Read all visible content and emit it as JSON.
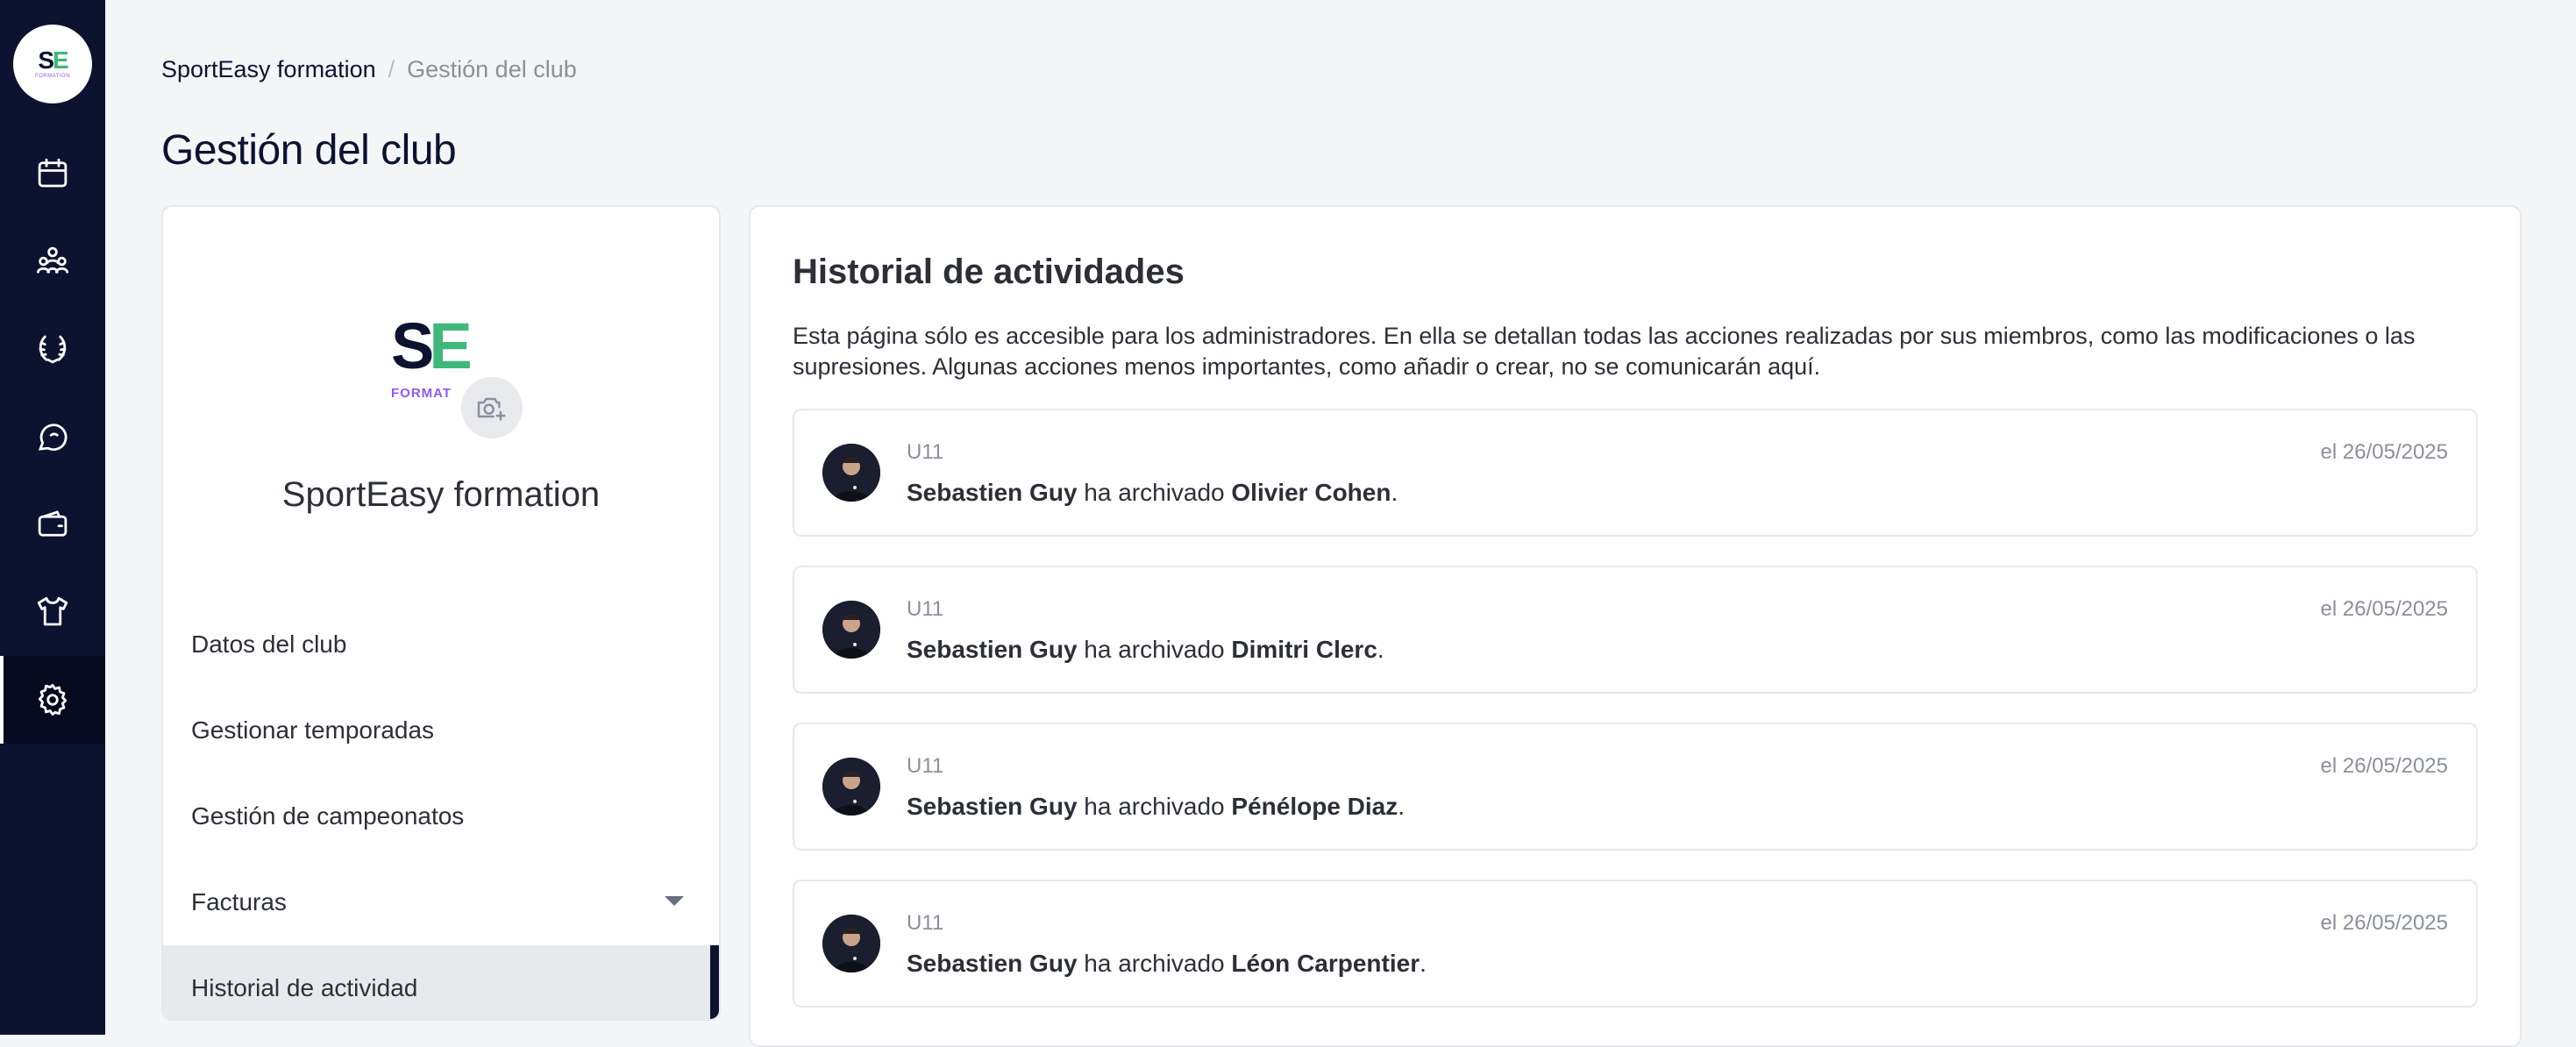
{
  "rail": {
    "logo_s": "S",
    "logo_e": "E",
    "logo_sub": "FORMATION",
    "items": [
      {
        "icon": "calendar-icon"
      },
      {
        "icon": "team-icon"
      },
      {
        "icon": "laurel-icon"
      },
      {
        "icon": "chat-icon"
      },
      {
        "icon": "wallet-icon"
      },
      {
        "icon": "shirt-icon"
      },
      {
        "icon": "gear-icon",
        "active": true
      }
    ]
  },
  "breadcrumb": {
    "root": "SportEasy formation",
    "separator": "/",
    "current": "Gestión del club"
  },
  "page_title": "Gestión del club",
  "club": {
    "logo_s": "S",
    "logo_e": "E",
    "logo_sub": "FORMAT",
    "name": "SportEasy formation",
    "menu": [
      {
        "label": "Datos del club"
      },
      {
        "label": "Gestionar temporadas"
      },
      {
        "label": "Gestión de campeonatos"
      },
      {
        "label": "Facturas",
        "has_dropdown": true
      },
      {
        "label": "Historial de actividad",
        "active": true
      }
    ]
  },
  "panel": {
    "title": "Historial de actividades",
    "description": "Esta página sólo es accesible para los administradores. En ella se detallan todas las acciones realizadas por sus miembros, como las modificaciones o las supresiones. Algunas acciones menos importantes, como añadir o crear, no se comunicarán aquí.",
    "activities": [
      {
        "team": "U11",
        "date": "el 26/05/2025",
        "actor": "Sebastien Guy",
        "action": " ha archivado ",
        "target": "Olivier Cohen",
        "end": "."
      },
      {
        "team": "U11",
        "date": "el 26/05/2025",
        "actor": "Sebastien Guy",
        "action": " ha archivado ",
        "target": "Dimitri Clerc",
        "end": "."
      },
      {
        "team": "U11",
        "date": "el 26/05/2025",
        "actor": "Sebastien Guy",
        "action": " ha archivado ",
        "target": "Pénélope Diaz",
        "end": "."
      },
      {
        "team": "U11",
        "date": "el 26/05/2025",
        "actor": "Sebastien Guy",
        "action": " ha archivado ",
        "target": "Léon Carpentier",
        "end": "."
      }
    ]
  },
  "colors": {
    "rail_bg": "#0b1330",
    "accent_green": "#3fb87a",
    "accent_purple": "#8b5cf6",
    "page_bg": "#f4f5f7"
  }
}
